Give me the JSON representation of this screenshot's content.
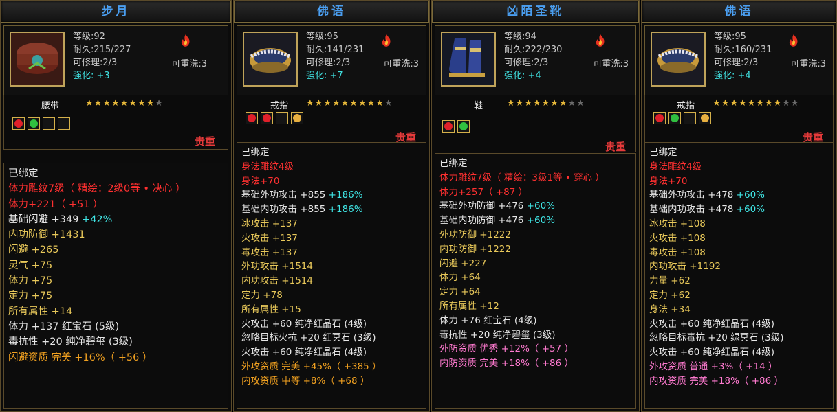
{
  "colors": {
    "title": "#4a9ef0",
    "red": "#ff2a2a",
    "white": "#e6e6e6",
    "cyan": "#40e6e6",
    "yellow": "#e8c85a",
    "orange": "#f0a020",
    "pink": "#ff7ad0",
    "grey": "#c8c8c8",
    "highlight_cyan": "#40e0e0"
  },
  "panels": [
    {
      "title": "步月",
      "title_color": "#4a9ef0",
      "level": "等级:92",
      "durability": "耐久:215/227",
      "repair": "可修理:2/3",
      "reforge": "可重洗:3",
      "enhance_label": "强化:",
      "enhance_value": "+3",
      "type": "腰带",
      "stars_on": 8,
      "stars_total": 9,
      "gems": [
        "red",
        "green",
        "empty",
        "empty"
      ],
      "value": "贵重",
      "bound": "已绑定",
      "attrs": [
        {
          "t": "体力雕纹7级（ 精绘：2级0等 • 决心 ）",
          "c": "#ff3030"
        },
        {
          "t": "体力+221（ +51 ）",
          "c": "#ff3030"
        },
        {
          "t": "基础闪避 +349",
          "t2": " +42%",
          "c": "#e6e6e6",
          "c2": "#40e6e6"
        },
        {
          "t": "内功防御 +1431",
          "c": "#e8c85a"
        },
        {
          "t": "闪避 +265",
          "c": "#e8c85a"
        },
        {
          "t": "灵气 +75",
          "c": "#e8c85a"
        },
        {
          "t": "体力 +75",
          "c": "#e8c85a"
        },
        {
          "t": "定力 +75",
          "c": "#e8c85a"
        },
        {
          "t": "所有属性 +14",
          "c": "#e8c85a"
        },
        {
          "t": "体力 +137  红宝石 (5级)",
          "c": "#e6e6e6"
        },
        {
          "t": "毒抗性 +20  纯净碧玺 (3级)",
          "c": "#e6e6e6"
        },
        {
          "t": "闪避资质   完美 +16%（ +56 ）",
          "c": "#f0a020"
        }
      ]
    },
    {
      "title": "佛语",
      "title_color": "#4a9ef0",
      "level": "等级:95",
      "durability": "耐久:141/231",
      "repair": "可修理:2/3",
      "reforge": "可重洗:3",
      "enhance_label": "强化:",
      "enhance_value": "+7",
      "type": "戒指",
      "stars_on": 9,
      "stars_total": 10,
      "gems": [
        "red",
        "red",
        "empty",
        "yellow"
      ],
      "value": "贵重",
      "bound": "已绑定",
      "attrs": [
        {
          "t": "身法雕纹4级",
          "c": "#ff3030"
        },
        {
          "t": "身法+70",
          "c": "#ff3030"
        },
        {
          "t": "基础外功攻击 +855",
          "t2": " +186%",
          "c": "#e6e6e6",
          "c2": "#40e6e6"
        },
        {
          "t": "基础内功攻击 +855",
          "t2": " +186%",
          "c": "#e6e6e6",
          "c2": "#40e6e6"
        },
        {
          "t": "冰攻击 +137",
          "c": "#e8c85a"
        },
        {
          "t": "火攻击 +137",
          "c": "#e8c85a"
        },
        {
          "t": "毒攻击 +137",
          "c": "#e8c85a"
        },
        {
          "t": "外功攻击 +1514",
          "c": "#e8c85a"
        },
        {
          "t": "内功攻击 +1514",
          "c": "#e8c85a"
        },
        {
          "t": "定力 +78",
          "c": "#e8c85a"
        },
        {
          "t": "所有属性 +15",
          "c": "#e8c85a"
        },
        {
          "t": "火攻击 +60  纯净红晶石 (4级)",
          "c": "#e6e6e6"
        },
        {
          "t": "忽略目标火抗 +20  红冥石 (3级)",
          "c": "#e6e6e6"
        },
        {
          "t": "火攻击 +60  纯净红晶石 (4级)",
          "c": "#e6e6e6"
        },
        {
          "t": "外攻资质   完美 +45%（ +385 ）",
          "c": "#f0a020"
        },
        {
          "t": "内攻资质   中等 +8%（ +68 ）",
          "c": "#f0a020"
        }
      ]
    },
    {
      "title": "凶陌圣靴",
      "title_color": "#4a9ef0",
      "level": "等级:94",
      "durability": "耐久:222/230",
      "repair": "可修理:2/3",
      "reforge": "可重洗:3",
      "enhance_label": "强化:",
      "enhance_value": "+4",
      "type": "鞋",
      "stars_on": 7,
      "stars_total": 9,
      "gems": [
        "red",
        "green"
      ],
      "value": "贵重",
      "bound": "已绑定",
      "attrs": [
        {
          "t": "体力雕纹7级（ 精绘：3级1等 • 穿心 ）",
          "c": "#ff3030"
        },
        {
          "t": "体力+257（ +87 ）",
          "c": "#ff3030"
        },
        {
          "t": "基础外功防御 +476",
          "t2": " +60%",
          "c": "#e6e6e6",
          "c2": "#40e6e6"
        },
        {
          "t": "基础内功防御 +476",
          "t2": " +60%",
          "c": "#e6e6e6",
          "c2": "#40e6e6"
        },
        {
          "t": "外功防御 +1222",
          "c": "#e8c85a"
        },
        {
          "t": "内功防御 +1222",
          "c": "#e8c85a"
        },
        {
          "t": "闪避 +227",
          "c": "#e8c85a"
        },
        {
          "t": "体力 +64",
          "c": "#e8c85a"
        },
        {
          "t": "定力 +64",
          "c": "#e8c85a"
        },
        {
          "t": "所有属性 +12",
          "c": "#e8c85a"
        },
        {
          "t": "体力 +76  红宝石 (4级)",
          "c": "#e6e6e6"
        },
        {
          "t": "毒抗性 +20  纯净碧玺 (3级)",
          "c": "#e6e6e6"
        },
        {
          "t": "外防资质   优秀 +12%（ +57 ）",
          "c": "#ff7ad0"
        },
        {
          "t": "内防资质   完美 +18%（ +86 ）",
          "c": "#ff7ad0"
        }
      ]
    },
    {
      "title": "佛语",
      "title_color": "#4a9ef0",
      "level": "等级:95",
      "durability": "耐久:160/231",
      "repair": "可修理:2/3",
      "reforge": "可重洗:3",
      "enhance_label": "强化:",
      "enhance_value": "+4",
      "type": "戒指",
      "stars_on": 8,
      "stars_total": 10,
      "gems": [
        "red",
        "green",
        "empty",
        "yellow"
      ],
      "value": "贵重",
      "bound": "已绑定",
      "attrs": [
        {
          "t": "身法雕纹4级",
          "c": "#ff3030"
        },
        {
          "t": "身法+70",
          "c": "#ff3030"
        },
        {
          "t": "基础外功攻击 +478",
          "t2": " +60%",
          "c": "#e6e6e6",
          "c2": "#40e6e6"
        },
        {
          "t": "基础内功攻击 +478",
          "t2": " +60%",
          "c": "#e6e6e6",
          "c2": "#40e6e6"
        },
        {
          "t": "冰攻击 +108",
          "c": "#e8c85a"
        },
        {
          "t": "火攻击 +108",
          "c": "#e8c85a"
        },
        {
          "t": "毒攻击 +108",
          "c": "#e8c85a"
        },
        {
          "t": "内功攻击 +1192",
          "c": "#e8c85a"
        },
        {
          "t": "力量 +62",
          "c": "#e8c85a"
        },
        {
          "t": "定力 +62",
          "c": "#e8c85a"
        },
        {
          "t": "身法 +34",
          "c": "#e8c85a"
        },
        {
          "t": "火攻击 +60  纯净红晶石 (4级)",
          "c": "#e6e6e6"
        },
        {
          "t": "忽略目标毒抗 +20  绿冥石 (3级)",
          "c": "#e6e6e6"
        },
        {
          "t": "火攻击 +60  纯净红晶石 (4级)",
          "c": "#e6e6e6"
        },
        {
          "t": "外攻资质   普通 +3%（ +14 ）",
          "c": "#ff7ad0"
        },
        {
          "t": "内攻资质   完美 +18%（ +86 ）",
          "c": "#ff7ad0"
        }
      ]
    }
  ]
}
